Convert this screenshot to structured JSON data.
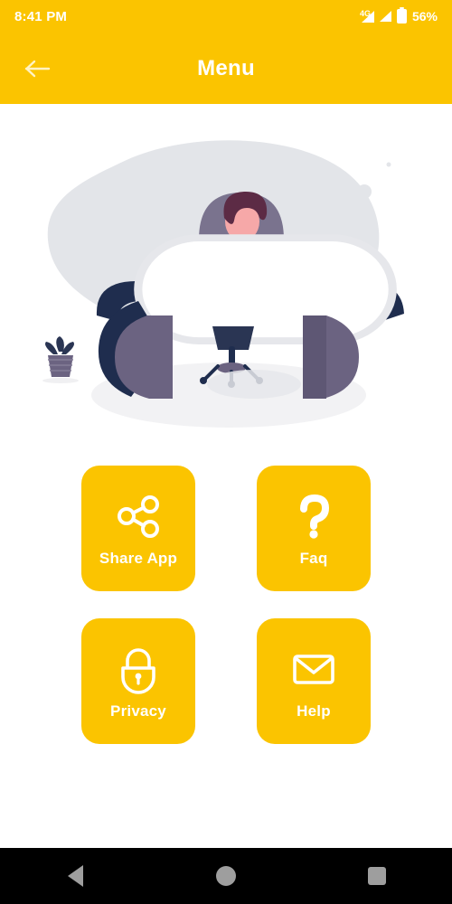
{
  "status_bar": {
    "time": "8:41 PM",
    "network_type": "4G",
    "battery_percent": "56%",
    "icons": [
      "signal-4g-icon",
      "signal-icon",
      "battery-icon"
    ]
  },
  "app_bar": {
    "title": "Menu",
    "back_icon": "arrow-left-icon"
  },
  "illustration": {
    "name": "person-at-desk-illustration",
    "alt": "Person working at a curved office desk with chair and plants"
  },
  "menu": {
    "tiles": [
      {
        "id": "share-app",
        "label": "Share App",
        "icon": "share-icon"
      },
      {
        "id": "faq",
        "label": "Faq",
        "icon": "question-mark-icon"
      },
      {
        "id": "privacy",
        "label": "Privacy",
        "icon": "lock-icon"
      },
      {
        "id": "help",
        "label": "Help",
        "icon": "envelope-icon"
      }
    ]
  },
  "navigation_bar": {
    "back": "nav-back-icon",
    "home": "nav-home-icon",
    "recents": "nav-recents-icon"
  },
  "colors": {
    "brand_yellow": "#FBC400",
    "tile_text": "#FFFFFF",
    "illustration_dark": "#1F2D4E",
    "illustration_purple": "#6B6381",
    "illustration_gray": "#E2E4E8",
    "skin": "#F6A8A8",
    "hair": "#5C2B45",
    "nav_bar_bg": "#000000",
    "nav_icon": "#9E9E9E"
  }
}
